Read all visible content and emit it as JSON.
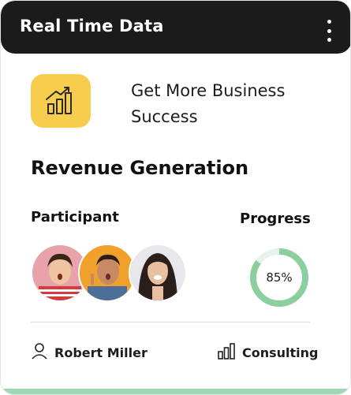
{
  "header": {
    "title": "Real Time Data",
    "menu_icon": "kebab-menu-icon"
  },
  "banner": {
    "icon": "bar-chart-growth-icon",
    "headline": "Get More Business Success",
    "icon_color": "#F7CD4D"
  },
  "section": {
    "title": "Revenue Generation"
  },
  "participants": {
    "label": "Participant",
    "avatar_count": 3
  },
  "progress": {
    "label": "Progress",
    "value_text": "85%",
    "value": 85,
    "color": "#8CCF9E",
    "track_color": "#E7F3EA"
  },
  "footer": {
    "person_icon": "user-icon",
    "person_name": "Robert Miller",
    "category_icon": "bar-chart-icon",
    "category": "Consulting"
  },
  "colors": {
    "header_bg": "#1B1B1B",
    "accent_bottom": "#9ED8B4"
  }
}
